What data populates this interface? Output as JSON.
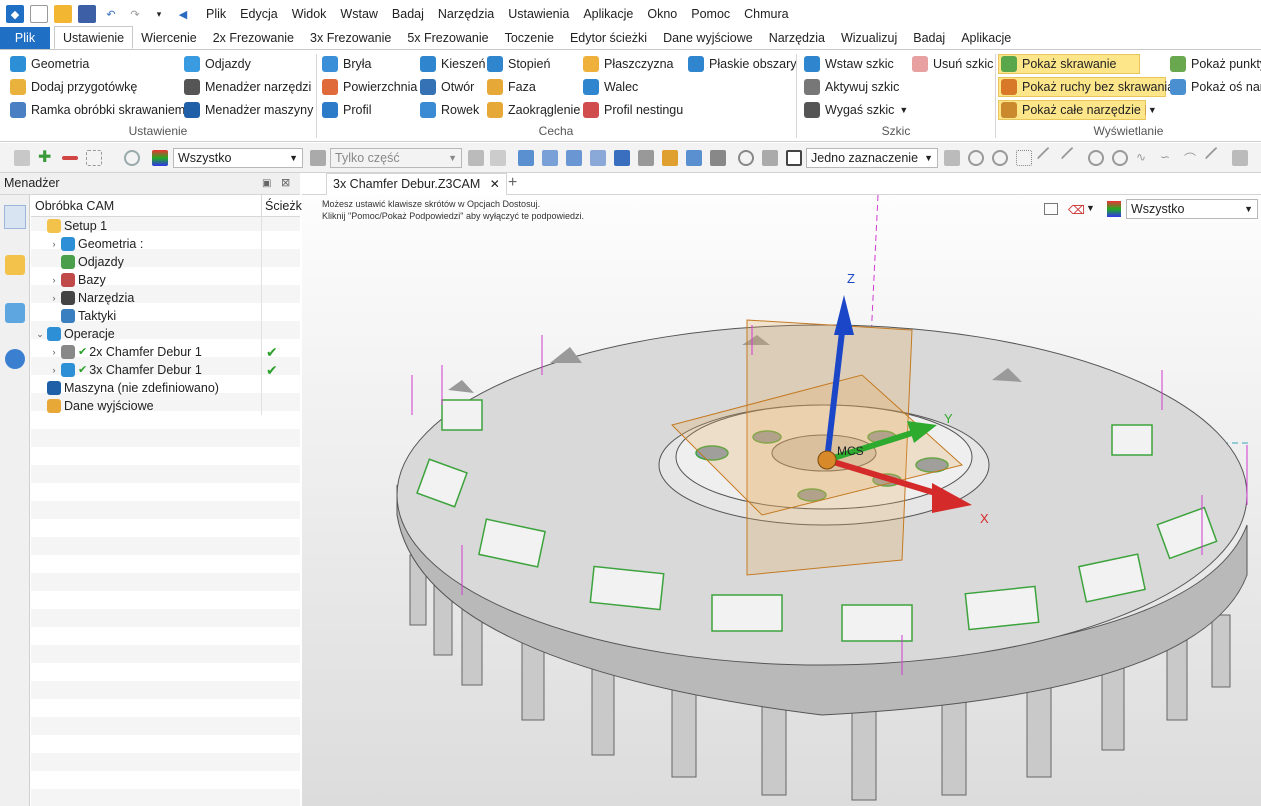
{
  "menubar": {
    "items": [
      "Plik",
      "Edycja",
      "Widok",
      "Wstaw",
      "Badaj",
      "Narzędzia",
      "Ustawienia",
      "Aplikacje",
      "Okno",
      "Pomoc",
      "Chmura"
    ]
  },
  "ribbon_tabs": [
    "Plik",
    "Ustawienie",
    "Wiercenie",
    "2x Frezowanie",
    "3x Frezowanie",
    "5x Frezowanie",
    "Toczenie",
    "Edytor ścieżki",
    "Dane wyjściowe",
    "Narzędzia",
    "Wizualizuj",
    "Badaj",
    "Aplikacje"
  ],
  "ribbon": {
    "setup": {
      "geometry": "Geometria",
      "stock": "Dodaj przygotówkę",
      "frame": "Ramka obróbki skrawaniem",
      "approaches": "Odjazdy",
      "tool_mgr": "Menadżer narzędzi",
      "machine_mgr": "Menadżer maszyny",
      "group": "Ustawienie"
    },
    "feature": {
      "solid": "Bryła",
      "surface": "Powierzchnia",
      "profile": "Profil",
      "pocket": "Kieszeń",
      "hole": "Otwór",
      "slot": "Rowek",
      "step": "Stopień",
      "chamfer": "Faza",
      "fillet": "Zaokrąglenie",
      "plane": "Płaszczyzna",
      "cylinder": "Walec",
      "nesting": "Profil nestingu",
      "flat": "Płaskie obszary",
      "group": "Cecha"
    },
    "sketch": {
      "insert": "Wstaw szkic",
      "active": "Aktywuj szkic",
      "extinguish": "Wygaś szkic",
      "delete": "Usuń szkic",
      "group": "Szkic"
    },
    "display": {
      "cutting": "Pokaż skrawanie",
      "noncut": "Pokaż ruchy bez skrawania",
      "wholetool": "Pokaż całe narzędzie",
      "points": "Pokaż punkty",
      "axis": "Pokaż oś narz",
      "group": "Wyświetlanie"
    }
  },
  "toolbar": {
    "filter": "Wszystko",
    "part_only": "Tylko część",
    "selection_mode": "Jedno zaznaczenie"
  },
  "manager": {
    "title": "Menadżer",
    "col_cam": "Obróbka CAM",
    "col_path": "Ścieżk",
    "rows": [
      {
        "label": "Setup 1",
        "chev": ""
      },
      {
        "label": "Geometria :",
        "chev": "›"
      },
      {
        "label": "Odjazdy",
        "chev": ""
      },
      {
        "label": "Bazy",
        "chev": "›"
      },
      {
        "label": "Narzędzia",
        "chev": "›"
      },
      {
        "label": "Taktyki",
        "chev": ""
      },
      {
        "label": "Operacje",
        "chev": "⌄"
      },
      {
        "label": "2x Chamfer Debur 1",
        "chev": "›",
        "check": "✔"
      },
      {
        "label": "3x Chamfer Debur 1",
        "chev": "›",
        "check": "✔"
      },
      {
        "label": "Maszyna (nie zdefiniowano)",
        "chev": ""
      },
      {
        "label": "Dane wyjściowe",
        "chev": ""
      }
    ]
  },
  "document": {
    "tab": "3x Chamfer Debur.Z3CAM",
    "hint1": "Możesz ustawić klawisze skrótów w Opcjach Dostosuj.",
    "hint2": "Kliknij \"Pomoc/Pokaż Podpowiedzi\" aby wyłączyć te podpowiedzi.",
    "view_filter": "Wszystko",
    "axis_z": "Z",
    "axis_y": "Y",
    "axis_x": "X",
    "mcs": "MCS"
  }
}
